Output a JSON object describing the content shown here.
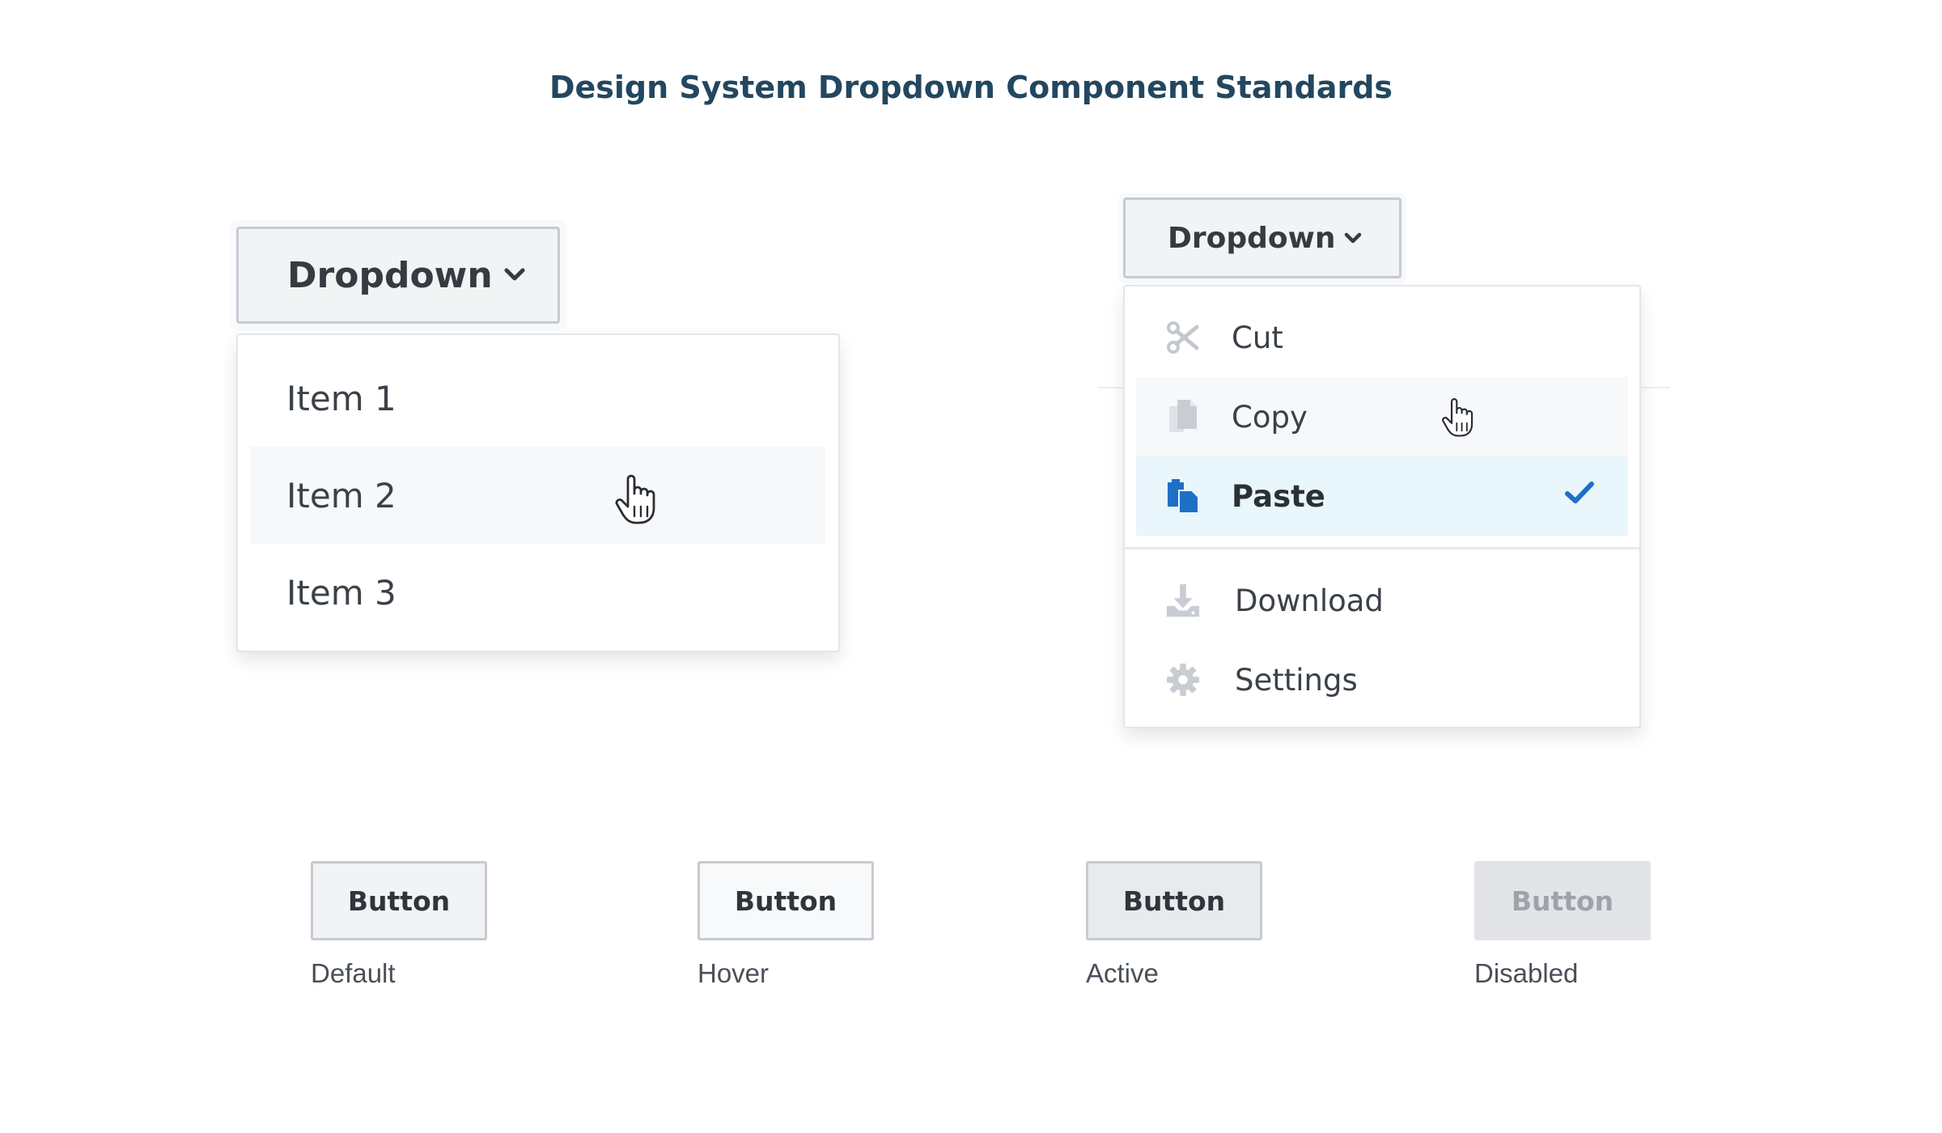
{
  "page": {
    "title": "Design System Dropdown Component Standards"
  },
  "left_dropdown": {
    "toggle_label": "Dropdown",
    "items": [
      {
        "label": "Item 1"
      },
      {
        "label": "Item 2",
        "state": "hover"
      },
      {
        "label": "Item 3"
      }
    ]
  },
  "right_dropdown": {
    "toggle_label": "Dropdown",
    "items": [
      {
        "label": "Cut",
        "icon": "scissors-icon"
      },
      {
        "label": "Copy",
        "icon": "copy-icon",
        "state": "hover"
      },
      {
        "label": "Paste",
        "icon": "paste-icon",
        "state": "selected"
      },
      {
        "label": "Download",
        "icon": "download-icon"
      },
      {
        "label": "Settings",
        "icon": "gear-icon"
      }
    ]
  },
  "buttons": [
    {
      "label": "Button",
      "state_label": "Default"
    },
    {
      "label": "Button",
      "state_label": "Hover"
    },
    {
      "label": "Button",
      "state_label": "Active"
    },
    {
      "label": "Button",
      "state_label": "Disabled"
    }
  ],
  "colors": {
    "title": "#23475f",
    "selected_bg": "#e9f6fc",
    "selected_icon": "#1f6fc5",
    "check": "#1f6fc5",
    "muted_icon": "#c3c8ce"
  }
}
